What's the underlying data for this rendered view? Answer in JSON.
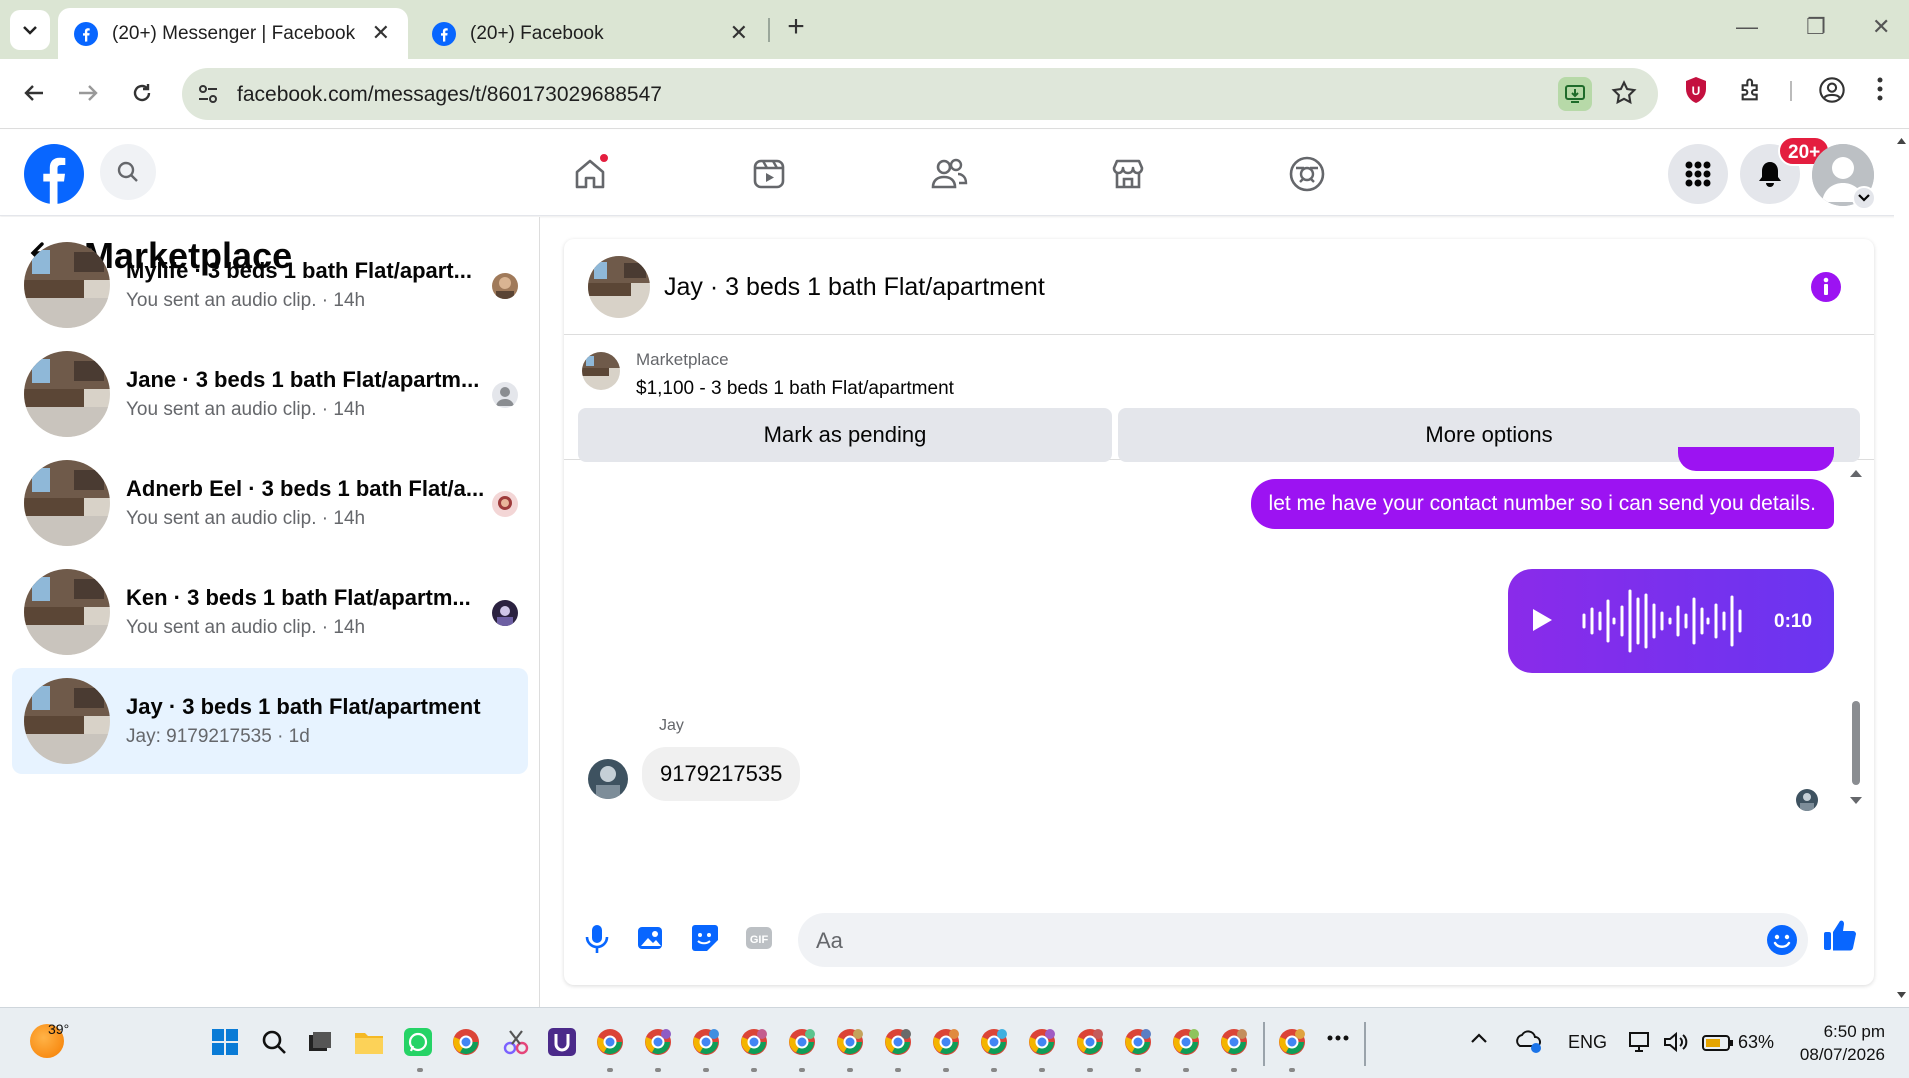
{
  "browser": {
    "tabs": [
      {
        "title": "(20+) Messenger | Facebook",
        "active": true
      },
      {
        "title": "(20+) Facebook",
        "active": false
      }
    ],
    "url": "facebook.com/messages/t/860173029688547"
  },
  "fb": {
    "notification_count": "20+",
    "colors": {
      "brand": "#0866ff",
      "accent": "#9c13f2",
      "badge": "#e41e3f"
    }
  },
  "sidebar": {
    "title": "Marketplace",
    "conversations": [
      {
        "name": "Mylife · 3 beds 1 bath Flat/apart...",
        "preview": "You sent an audio clip. · 14h",
        "selected": false
      },
      {
        "name": "Jane · 3 beds 1 bath Flat/apartm...",
        "preview": "You sent an audio clip. · 14h",
        "selected": false
      },
      {
        "name": "Adnerb Eel · 3 beds 1 bath Flat/a...",
        "preview": "You sent an audio clip. · 14h",
        "selected": false
      },
      {
        "name": "Ken · 3 beds 1 bath Flat/apartm...",
        "preview": "You sent an audio clip. · 14h",
        "selected": false
      },
      {
        "name": "Jay · 3 beds 1 bath Flat/apartment",
        "preview": "Jay: 9179217535 · 1d",
        "selected": true
      }
    ]
  },
  "chat": {
    "title": "Jay · 3 beds 1 bath Flat/apartment",
    "listing": {
      "category": "Marketplace",
      "title": "$1,100 - 3 beds 1 bath Flat/apartment",
      "primary_button": "Mark as pending",
      "secondary_button": "More options"
    },
    "messages": {
      "sent_text": "let me have your contact number so i can send you details.",
      "audio_duration": "0:10",
      "received_sender": "Jay",
      "received_text": "9179217535"
    },
    "composer_placeholder": "Aa"
  },
  "taskbar": {
    "temperature": "39°",
    "language": "ENG",
    "battery": "63%",
    "time": "6:50 pm",
    "date": "08/07/2026"
  }
}
